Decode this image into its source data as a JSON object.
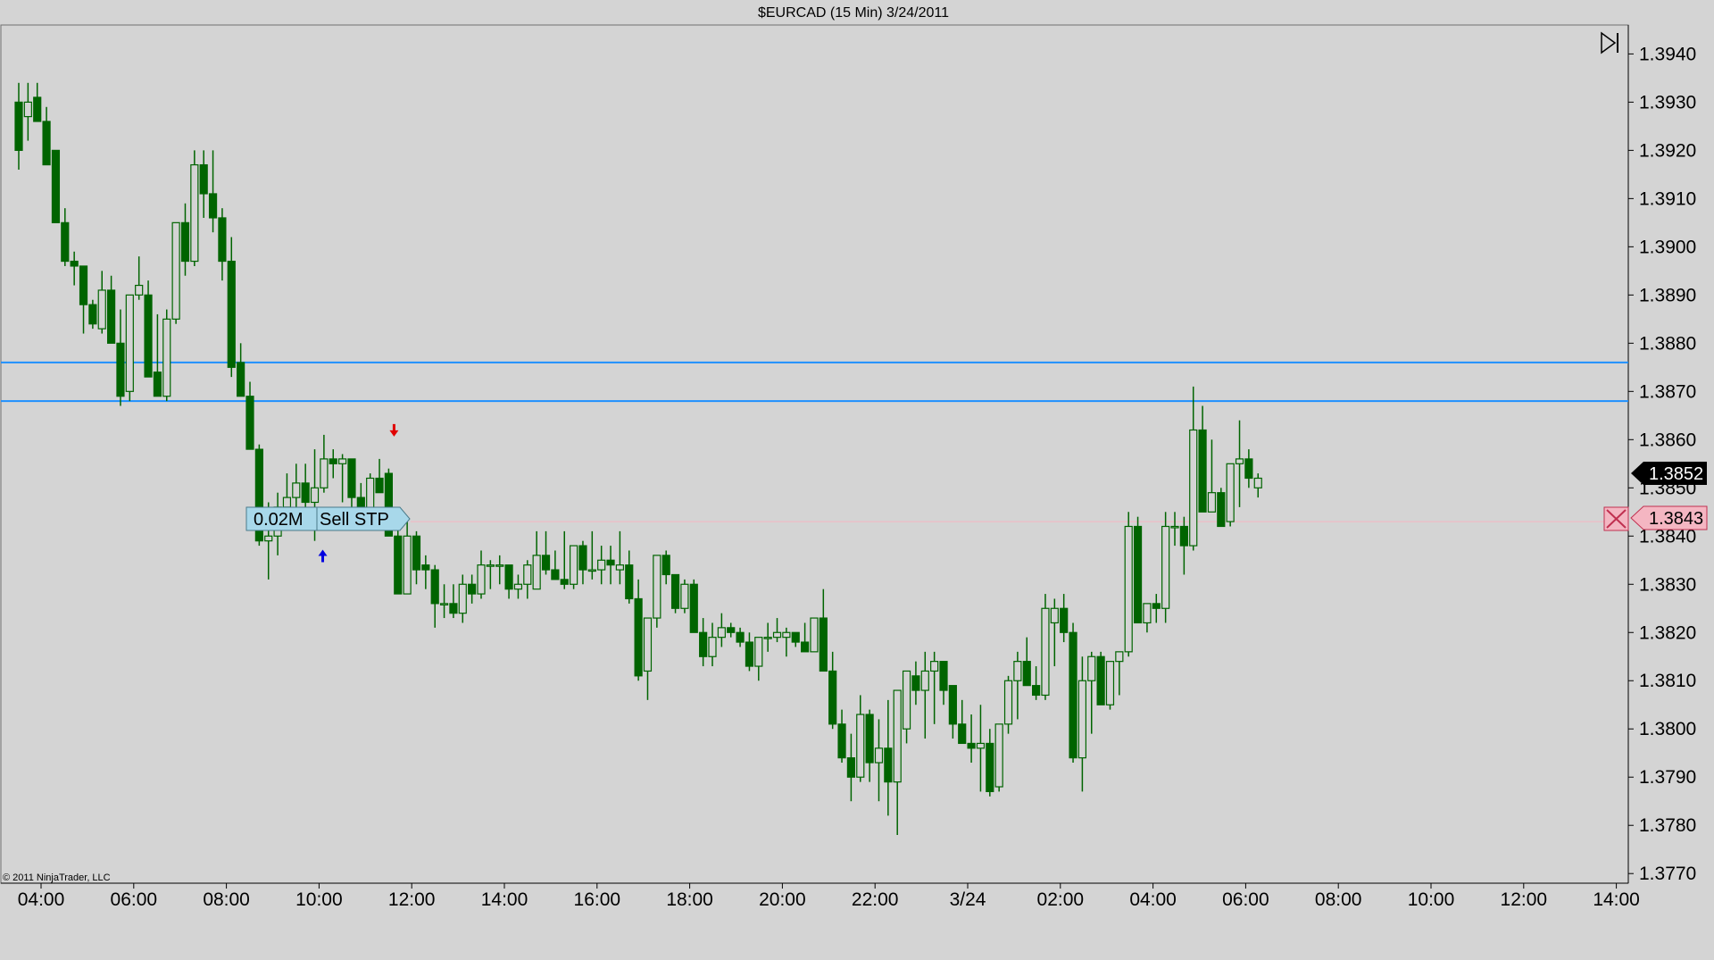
{
  "window_title": "$EURCAD (15 Min)  3/24/2011",
  "copyright": "© 2011 NinjaTrader, LLC",
  "order_label": {
    "quantity": "0.02M",
    "type": "Sell STP"
  },
  "colors": {
    "background": "#d4d4d4",
    "up_candle": "#d4d4d4",
    "down_candle": "#006400",
    "wick": "#006400",
    "horizontal_line": "#1e90ff",
    "order_line": "#f4b6c2",
    "order_tag": "#a8d8ea",
    "last_price_tag": "#000000",
    "stop_price_tag": "#f4b6c2"
  },
  "chart_data": {
    "type": "candlestick",
    "title": "$EURCAD (15 Min)  3/24/2011",
    "ylim": [
      1.3768,
      1.3946
    ],
    "x_ticks": [
      "04:00",
      "06:00",
      "08:00",
      "10:00",
      "12:00",
      "14:00",
      "16:00",
      "18:00",
      "20:00",
      "22:00",
      "3/24",
      "02:00",
      "04:00",
      "06:00",
      "08:00",
      "10:00",
      "12:00",
      "14:00"
    ],
    "y_ticks": [
      "1.3940",
      "1.3930",
      "1.3920",
      "1.3910",
      "1.3900",
      "1.3890",
      "1.3880",
      "1.3870",
      "1.3860",
      "1.3850",
      "1.3840",
      "1.3830",
      "1.3820",
      "1.3810",
      "1.3800",
      "1.3790",
      "1.3780",
      "1.3770"
    ],
    "grid": false,
    "horizontal_lines": [
      1.3876,
      1.3868
    ],
    "order_line_price": 1.3843,
    "last_price": "1.3852",
    "stop_price": "1.3843",
    "markers": [
      {
        "type": "arrow-down",
        "color": "#e00000",
        "bar": 40,
        "price": 1.3861
      },
      {
        "type": "arrow-up",
        "color": "#0000e0",
        "bar": 32,
        "price": 1.3837
      }
    ],
    "candles": [
      [
        1.393,
        1.3934,
        1.3916,
        1.392
      ],
      [
        1.3927,
        1.3934,
        1.3922,
        1.393
      ],
      [
        1.3931,
        1.3934,
        1.3926,
        1.3926
      ],
      [
        1.3926,
        1.3929,
        1.3918,
        1.3917
      ],
      [
        1.392,
        1.3919,
        1.3905,
        1.3905
      ],
      [
        1.3905,
        1.3908,
        1.3896,
        1.3897
      ],
      [
        1.3897,
        1.3899,
        1.3892,
        1.3896
      ],
      [
        1.3896,
        1.3896,
        1.3882,
        1.3888
      ],
      [
        1.3888,
        1.3889,
        1.3883,
        1.3884
      ],
      [
        1.3883,
        1.3895,
        1.3882,
        1.3891
      ],
      [
        1.3891,
        1.3894,
        1.388,
        1.388
      ],
      [
        1.388,
        1.3887,
        1.3867,
        1.3869
      ],
      [
        1.387,
        1.389,
        1.3868,
        1.389
      ],
      [
        1.389,
        1.3898,
        1.3889,
        1.3892
      ],
      [
        1.389,
        1.3893,
        1.3873,
        1.3873
      ],
      [
        1.3874,
        1.3886,
        1.387,
        1.3869
      ],
      [
        1.3869,
        1.3887,
        1.3868,
        1.3885
      ],
      [
        1.3885,
        1.3905,
        1.3884,
        1.3905
      ],
      [
        1.3905,
        1.3909,
        1.3894,
        1.3897
      ],
      [
        1.3897,
        1.392,
        1.3896,
        1.3917
      ],
      [
        1.3917,
        1.392,
        1.3906,
        1.3911
      ],
      [
        1.3911,
        1.392,
        1.3903,
        1.3906
      ],
      [
        1.3906,
        1.3908,
        1.3893,
        1.3897
      ],
      [
        1.3897,
        1.3902,
        1.3873,
        1.3875
      ],
      [
        1.3876,
        1.388,
        1.3872,
        1.3869
      ],
      [
        1.3869,
        1.3872,
        1.3864,
        1.3858
      ],
      [
        1.3858,
        1.3859,
        1.3838,
        1.3839
      ],
      [
        1.3839,
        1.3847,
        1.3831,
        1.384
      ],
      [
        1.384,
        1.3849,
        1.3836,
        1.3846
      ],
      [
        1.3846,
        1.3853,
        1.3845,
        1.3848
      ],
      [
        1.3848,
        1.3855,
        1.3845,
        1.3851
      ],
      [
        1.3851,
        1.3855,
        1.3845,
        1.3847
      ],
      [
        1.3847,
        1.3858,
        1.3839,
        1.385
      ],
      [
        1.385,
        1.3861,
        1.3849,
        1.3856
      ],
      [
        1.3856,
        1.3858,
        1.3852,
        1.3855
      ],
      [
        1.3855,
        1.3857,
        1.3847,
        1.3856
      ],
      [
        1.3856,
        1.3856,
        1.3846,
        1.3848
      ],
      [
        1.3848,
        1.3851,
        1.3842,
        1.3845
      ],
      [
        1.3845,
        1.3853,
        1.3844,
        1.3852
      ],
      [
        1.3852,
        1.3856,
        1.3849,
        1.3849
      ],
      [
        1.3853,
        1.3854,
        1.384,
        1.384
      ],
      [
        1.384,
        1.3845,
        1.3828,
        1.3828
      ],
      [
        1.3828,
        1.3843,
        1.383,
        1.384
      ],
      [
        1.384,
        1.3841,
        1.383,
        1.3833
      ],
      [
        1.3834,
        1.3836,
        1.3829,
        1.3833
      ],
      [
        1.3833,
        1.3834,
        1.3821,
        1.3826
      ],
      [
        1.3826,
        1.383,
        1.3823,
        1.3826
      ],
      [
        1.3826,
        1.383,
        1.3823,
        1.3824
      ],
      [
        1.3824,
        1.3832,
        1.3822,
        1.383
      ],
      [
        1.383,
        1.3832,
        1.3826,
        1.3828
      ],
      [
        1.3828,
        1.3837,
        1.3827,
        1.3834
      ],
      [
        1.3834,
        1.3835,
        1.3829,
        1.3834
      ],
      [
        1.3834,
        1.3836,
        1.383,
        1.3834
      ],
      [
        1.3834,
        1.3834,
        1.3827,
        1.3829
      ],
      [
        1.3829,
        1.3832,
        1.3827,
        1.383
      ],
      [
        1.383,
        1.3835,
        1.3827,
        1.3834
      ],
      [
        1.3829,
        1.3841,
        1.3829,
        1.3836
      ],
      [
        1.3836,
        1.3841,
        1.3832,
        1.3833
      ],
      [
        1.3833,
        1.3837,
        1.3831,
        1.3831
      ],
      [
        1.3831,
        1.3841,
        1.3829,
        1.383
      ],
      [
        1.383,
        1.3837,
        1.3829,
        1.3838
      ],
      [
        1.3838,
        1.3839,
        1.383,
        1.3833
      ],
      [
        1.3833,
        1.3841,
        1.3831,
        1.3833
      ],
      [
        1.3833,
        1.3838,
        1.383,
        1.3835
      ],
      [
        1.3835,
        1.3838,
        1.383,
        1.3834
      ],
      [
        1.3833,
        1.3841,
        1.383,
        1.3834
      ],
      [
        1.3834,
        1.3837,
        1.3826,
        1.3827
      ],
      [
        1.3827,
        1.3831,
        1.381,
        1.3811
      ],
      [
        1.3812,
        1.3823,
        1.3806,
        1.3823
      ],
      [
        1.3823,
        1.3836,
        1.3821,
        1.3836
      ],
      [
        1.3836,
        1.3837,
        1.383,
        1.3832
      ],
      [
        1.3832,
        1.3832,
        1.3824,
        1.3825
      ],
      [
        1.3825,
        1.3831,
        1.3824,
        1.383
      ],
      [
        1.383,
        1.3831,
        1.382,
        1.382
      ],
      [
        1.382,
        1.3823,
        1.3813,
        1.3815
      ],
      [
        1.3815,
        1.3822,
        1.3813,
        1.3819
      ],
      [
        1.3819,
        1.3824,
        1.3817,
        1.3821
      ],
      [
        1.3821,
        1.3822,
        1.3819,
        1.382
      ],
      [
        1.382,
        1.3821,
        1.3817,
        1.3818
      ],
      [
        1.3818,
        1.382,
        1.3812,
        1.3813
      ],
      [
        1.3813,
        1.3818,
        1.381,
        1.3819
      ],
      [
        1.3819,
        1.3822,
        1.3816,
        1.3819
      ],
      [
        1.3819,
        1.3823,
        1.3818,
        1.382
      ],
      [
        1.3819,
        1.3821,
        1.3815,
        1.382
      ],
      [
        1.382,
        1.382,
        1.3817,
        1.3818
      ],
      [
        1.3818,
        1.3822,
        1.3816,
        1.3816
      ],
      [
        1.3816,
        1.3823,
        1.3818,
        1.3823
      ],
      [
        1.3823,
        1.3829,
        1.382,
        1.3812
      ],
      [
        1.3812,
        1.3816,
        1.38,
        1.3801
      ],
      [
        1.3801,
        1.3804,
        1.3793,
        1.3794
      ],
      [
        1.3794,
        1.3799,
        1.3785,
        1.379
      ],
      [
        1.379,
        1.3807,
        1.3789,
        1.3803
      ],
      [
        1.3803,
        1.3804,
        1.3789,
        1.3793
      ],
      [
        1.3793,
        1.3802,
        1.3785,
        1.3796
      ],
      [
        1.3796,
        1.3806,
        1.3782,
        1.3789
      ],
      [
        1.3789,
        1.3808,
        1.3778,
        1.3808
      ],
      [
        1.38,
        1.3812,
        1.3797,
        1.3812
      ],
      [
        1.3811,
        1.3814,
        1.3805,
        1.3808
      ],
      [
        1.3808,
        1.3816,
        1.3798,
        1.3812
      ],
      [
        1.3812,
        1.3816,
        1.3801,
        1.3814
      ],
      [
        1.3814,
        1.3814,
        1.3805,
        1.3808
      ],
      [
        1.3809,
        1.3808,
        1.3798,
        1.3801
      ],
      [
        1.3801,
        1.3806,
        1.3797,
        1.3797
      ],
      [
        1.3797,
        1.3803,
        1.3793,
        1.3796
      ],
      [
        1.3796,
        1.3805,
        1.3787,
        1.3797
      ],
      [
        1.3797,
        1.38,
        1.3786,
        1.3787
      ],
      [
        1.3788,
        1.3801,
        1.3787,
        1.3801
      ],
      [
        1.3801,
        1.3811,
        1.3799,
        1.381
      ],
      [
        1.381,
        1.3816,
        1.3802,
        1.3814
      ],
      [
        1.3814,
        1.3819,
        1.3809,
        1.3809
      ],
      [
        1.3809,
        1.3813,
        1.3806,
        1.3807
      ],
      [
        1.3807,
        1.3828,
        1.3806,
        1.3825
      ],
      [
        1.3822,
        1.3827,
        1.3813,
        1.3825
      ],
      [
        1.3825,
        1.3828,
        1.3818,
        1.382
      ],
      [
        1.382,
        1.3822,
        1.3793,
        1.3794
      ],
      [
        1.3794,
        1.3815,
        1.3787,
        1.381
      ],
      [
        1.381,
        1.3816,
        1.3799,
        1.3815
      ],
      [
        1.3815,
        1.3816,
        1.3807,
        1.3805
      ],
      [
        1.3805,
        1.3814,
        1.3804,
        1.3814
      ],
      [
        1.3814,
        1.3816,
        1.3807,
        1.3816
      ],
      [
        1.3816,
        1.3845,
        1.3815,
        1.3842
      ],
      [
        1.3842,
        1.3844,
        1.3823,
        1.3822
      ],
      [
        1.3822,
        1.3826,
        1.382,
        1.3826
      ],
      [
        1.3826,
        1.3828,
        1.3822,
        1.3825
      ],
      [
        1.3825,
        1.3845,
        1.3822,
        1.3842
      ],
      [
        1.3842,
        1.3845,
        1.3838,
        1.3842
      ],
      [
        1.3842,
        1.3844,
        1.3832,
        1.3838
      ],
      [
        1.3838,
        1.3871,
        1.3837,
        1.3862
      ],
      [
        1.3862,
        1.3867,
        1.3845,
        1.3845
      ],
      [
        1.3845,
        1.386,
        1.3845,
        1.3849
      ],
      [
        1.3849,
        1.385,
        1.3843,
        1.3842
      ],
      [
        1.3843,
        1.3855,
        1.3842,
        1.3855
      ],
      [
        1.3855,
        1.3864,
        1.3846,
        1.3856
      ],
      [
        1.3856,
        1.3858,
        1.385,
        1.3852
      ],
      [
        1.385,
        1.3853,
        1.3848,
        1.3852
      ]
    ]
  }
}
